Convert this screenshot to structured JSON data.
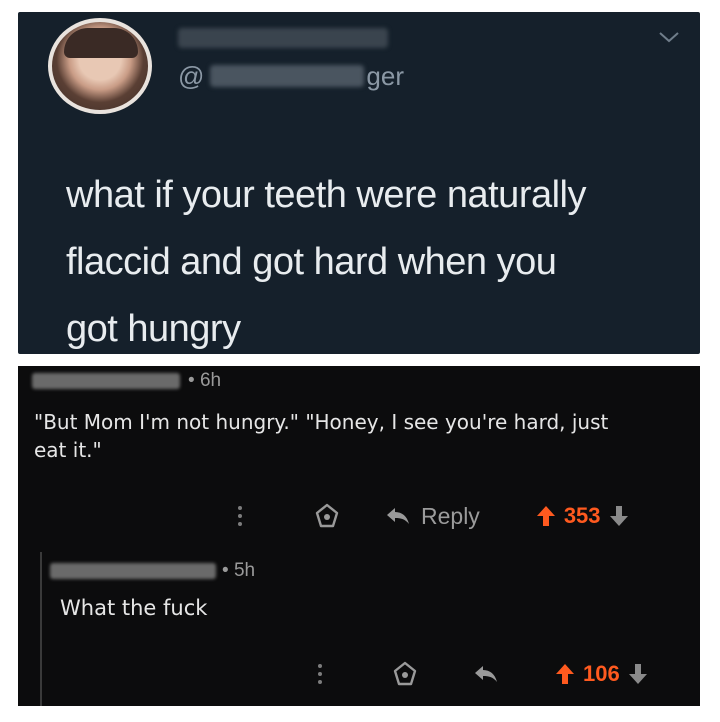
{
  "tweet": {
    "handle_prefix": "@",
    "handle_suffix": "ger",
    "text_lines": [
      "what if your teeth were naturally",
      "flaccid and got hard when you",
      "got hungry"
    ]
  },
  "comment": {
    "age": "6h",
    "text_line1": "\"But Mom I'm not hungry.\" \"Honey, I see you're hard, just",
    "text_line2": "eat it.\"",
    "reply_label": "Reply",
    "score": "353"
  },
  "reply": {
    "age": "5h",
    "text": "What the fuck",
    "score": "106"
  },
  "colors": {
    "tweet_bg": "#15202b",
    "reddit_bg": "#0c0c0d",
    "upvote": "#ff5a1f"
  },
  "icons": [
    "more-vertical-icon",
    "award-icon",
    "reply-arrow-icon",
    "upvote-arrow-icon",
    "downvote-arrow-icon",
    "chevron-down-icon"
  ]
}
